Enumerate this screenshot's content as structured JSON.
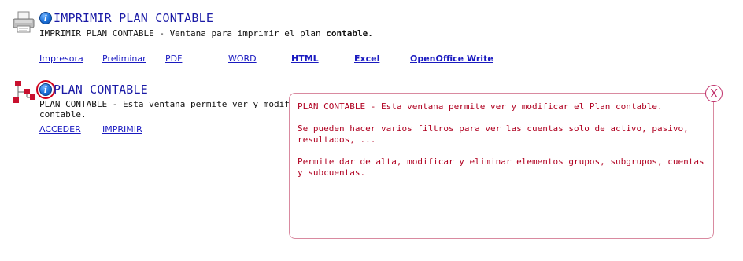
{
  "print_section": {
    "title": "IMPRIMIR PLAN CONTABLE",
    "desc_prefix": "IMPRIMIR PLAN CONTABLE - Ventana para imprimir el plan ",
    "desc_bold": "contable.",
    "links": [
      {
        "label": "Impresora"
      },
      {
        "label": "Preliminar"
      },
      {
        "label": "PDF"
      },
      {
        "label": "WORD"
      },
      {
        "label": "HTML"
      },
      {
        "label": "Excel"
      },
      {
        "label": "OpenOffice Write"
      }
    ]
  },
  "plan_section": {
    "title": "PLAN CONTABLE",
    "desc_line1": "PLAN CONTABLE - Esta ventana permite ver y modificar el Plan",
    "desc_line2": "contable.",
    "links": [
      {
        "label": "ACCEDER"
      },
      {
        "label": "IMPRIMIR"
      }
    ]
  },
  "tooltip": {
    "paragraphs": [
      "PLAN CONTABLE - Esta ventana permite ver y modificar el Plan contable.",
      "Se pueden hacer varios filtros para ver las cuentas solo de activo, pasivo, resultados, ...",
      "Permite dar de alta, modificar y eliminar elementos grupos, subgrupos, cuentas y subcuentas."
    ],
    "close_label": "X"
  },
  "icons": {
    "info": "info-icon",
    "printer": "printer-icon",
    "tree": "tree-structure-icon"
  },
  "colors": {
    "title": "#1a1aa6",
    "link": "#1a1ac0",
    "tooltip_text": "#b00020",
    "tooltip_border": "#d98aa0",
    "highlight": "#d0021b"
  }
}
